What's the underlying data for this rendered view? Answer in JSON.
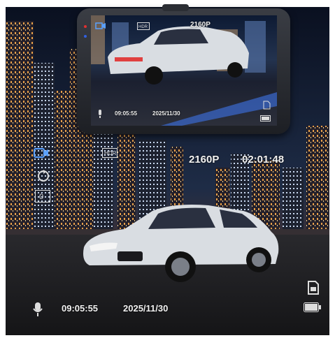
{
  "main_screen": {
    "resolution": "2160P",
    "elapsed_time": "02:01:48",
    "clock_time": "09:05:55",
    "date": "2025/11/30",
    "icons": [
      "video-camera-icon",
      "hdr-icon",
      "loop-recording-icon",
      "exposure-icon",
      "microphone-icon",
      "sd-card-icon",
      "battery-icon"
    ]
  },
  "device_screen": {
    "resolution": "2160P",
    "clock_time": "09:05:55",
    "date": "2025/11/30"
  },
  "colors": {
    "hud_text": "#f2f2f2",
    "car_body": "#d9dde2",
    "city_lights": "#f0b060",
    "led_red": "#e03030",
    "led_blue": "#3060e0"
  }
}
